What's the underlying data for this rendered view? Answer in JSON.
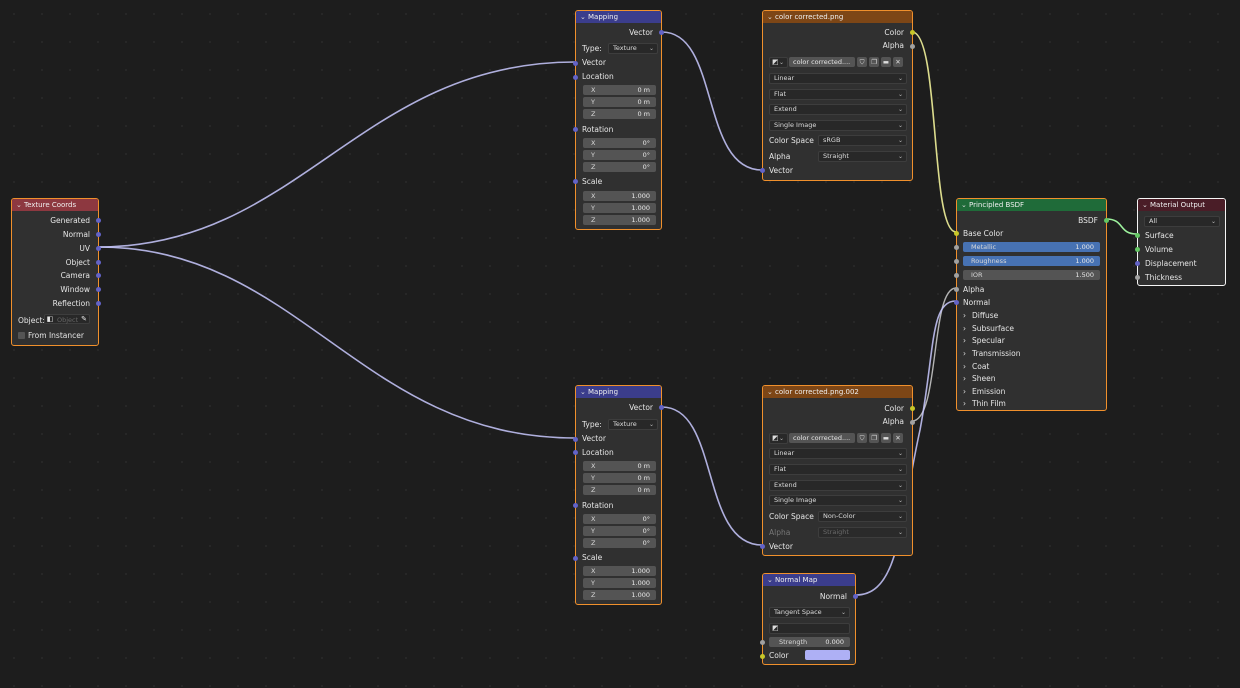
{
  "colors": {
    "vector_socket": "#6363c7",
    "color_socket": "#c7c729",
    "float_socket": "#a1a1a1",
    "shader_socket": "#63c763",
    "input_header": "#8d3840",
    "vector_header": "#3b3d8c",
    "texture_header": "#7d4616",
    "shader_header": "#1f6b39",
    "output_header": "#4a1d27",
    "selected_border": "#f0902c",
    "normal_map_color": "#aeb0f5"
  },
  "texcoord": {
    "title": "Texture Coords",
    "outputs": [
      "Generated",
      "Normal",
      "UV",
      "Object",
      "Camera",
      "Window",
      "Reflection"
    ],
    "object_label": "Object:",
    "object_placeholder": "Object",
    "from_instancer": "From Instancer"
  },
  "mapping1": {
    "title": "Mapping",
    "out_vector": "Vector",
    "type_label": "Type:",
    "type_value": "Texture",
    "in_vector": "Vector",
    "location_label": "Location",
    "location": [
      {
        "k": "X",
        "v": "0 m"
      },
      {
        "k": "Y",
        "v": "0 m"
      },
      {
        "k": "Z",
        "v": "0 m"
      }
    ],
    "rotation_label": "Rotation",
    "rotation": [
      {
        "k": "X",
        "v": "0°"
      },
      {
        "k": "Y",
        "v": "0°"
      },
      {
        "k": "Z",
        "v": "0°"
      }
    ],
    "scale_label": "Scale",
    "scale": [
      {
        "k": "X",
        "v": "1.000"
      },
      {
        "k": "Y",
        "v": "1.000"
      },
      {
        "k": "Z",
        "v": "1.000"
      }
    ]
  },
  "mapping2": {
    "title": "Mapping",
    "out_vector": "Vector",
    "type_label": "Type:",
    "type_value": "Texture",
    "in_vector": "Vector",
    "location_label": "Location",
    "location": [
      {
        "k": "X",
        "v": "0 m"
      },
      {
        "k": "Y",
        "v": "0 m"
      },
      {
        "k": "Z",
        "v": "0 m"
      }
    ],
    "rotation_label": "Rotation",
    "rotation": [
      {
        "k": "X",
        "v": "0°"
      },
      {
        "k": "Y",
        "v": "0°"
      },
      {
        "k": "Z",
        "v": "0°"
      }
    ],
    "scale_label": "Scale",
    "scale": [
      {
        "k": "X",
        "v": "1.000"
      },
      {
        "k": "Y",
        "v": "1.000"
      },
      {
        "k": "Z",
        "v": "1.000"
      }
    ]
  },
  "image1": {
    "title": "color corrected.png",
    "out_color": "Color",
    "out_alpha": "Alpha",
    "image_name": "color corrected....",
    "interpolation": "Linear",
    "projection": "Flat",
    "extension": "Extend",
    "source": "Single Image",
    "colorspace_label": "Color Space",
    "colorspace": "sRGB",
    "alpha_label": "Alpha",
    "alpha_mode": "Straight",
    "in_vector": "Vector"
  },
  "image2": {
    "title": "color corrected.png.002",
    "out_color": "Color",
    "out_alpha": "Alpha",
    "image_name": "color corrected....",
    "interpolation": "Linear",
    "projection": "Flat",
    "extension": "Extend",
    "source": "Single Image",
    "colorspace_label": "Color Space",
    "colorspace": "Non-Color",
    "alpha_label": "Alpha",
    "alpha_mode": "Straight",
    "in_vector": "Vector"
  },
  "normalmap": {
    "title": "Normal Map",
    "out_normal": "Normal",
    "space": "Tangent Space",
    "strength_label": "Strength",
    "strength_value": "0.000",
    "color_label": "Color"
  },
  "bsdf": {
    "title": "Principled BSDF",
    "out_bsdf": "BSDF",
    "base_color": "Base Color",
    "metallic_label": "Metallic",
    "metallic_value": "1.000",
    "roughness_label": "Roughness",
    "roughness_value": "1.000",
    "ior_label": "IOR",
    "ior_value": "1.500",
    "alpha": "Alpha",
    "normal": "Normal",
    "panels": [
      "Diffuse",
      "Subsurface",
      "Specular",
      "Transmission",
      "Coat",
      "Sheen",
      "Emission",
      "Thin Film"
    ]
  },
  "output": {
    "title": "Material Output",
    "target": "All",
    "inputs": [
      "Surface",
      "Volume",
      "Displacement",
      "Thickness"
    ]
  }
}
